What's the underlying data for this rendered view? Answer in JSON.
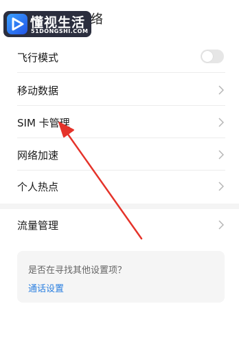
{
  "header": {
    "title_fragment": "络"
  },
  "watermark": {
    "name": "懂视生活",
    "domain": "51DONGSHI.COM"
  },
  "settings": {
    "airplane_mode": {
      "label": "飞行模式",
      "enabled": false
    },
    "items": [
      {
        "label": "移动数据"
      },
      {
        "label": "SIM 卡管理"
      },
      {
        "label": "网络加速"
      },
      {
        "label": "个人热点"
      }
    ],
    "data_usage": {
      "label": "流量管理"
    }
  },
  "suggestion_card": {
    "question": "是否在寻找其他设置项？",
    "link": "通话设置"
  },
  "colors": {
    "link": "#2a7fe0",
    "annotation_arrow": "#e5332a"
  }
}
